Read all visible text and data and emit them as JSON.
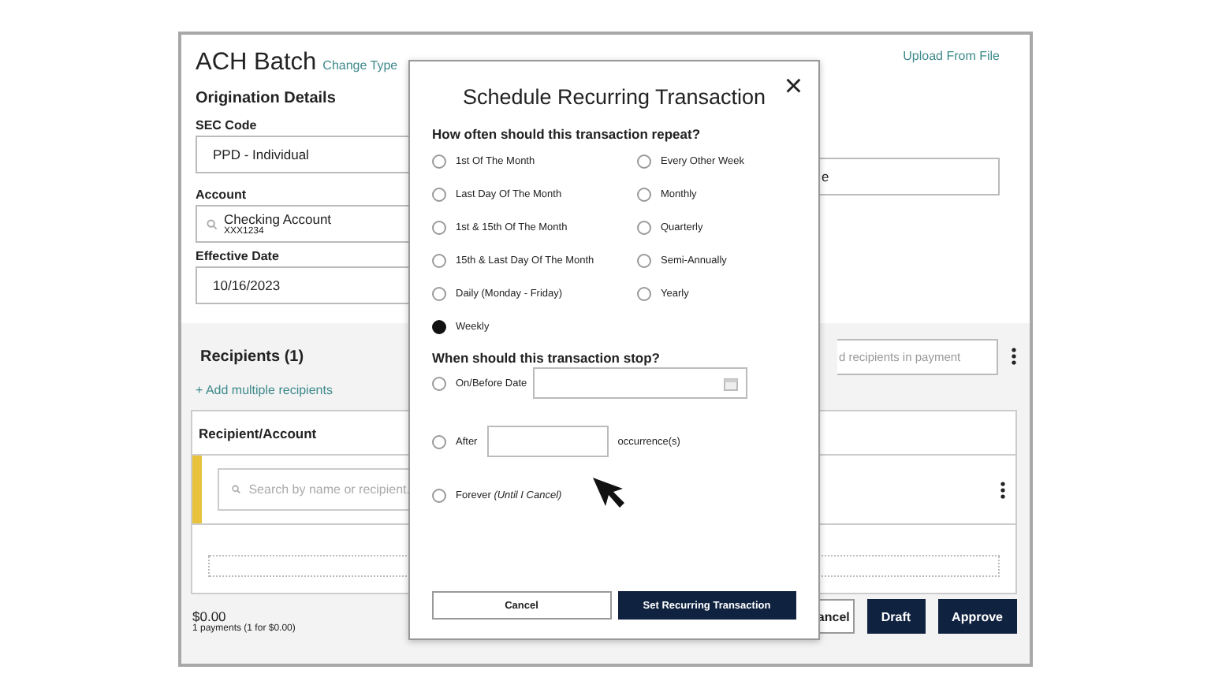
{
  "page": {
    "title": "ACH Batch",
    "change_link": "Change Type",
    "upload_link": "Upload From File",
    "section": "Origination Details",
    "fields": [
      {
        "label": "SEC Code",
        "value": "PPD - Individual"
      },
      {
        "label": "Account",
        "value": "Checking Account",
        "sub": "XXX1234",
        "kind": "search"
      },
      {
        "label": "Effective Date",
        "value": "10/16/2023"
      }
    ],
    "right_field_value": "e"
  },
  "recipients": {
    "title": "Recipients (1)",
    "search_placeholder": "d recipients in payment",
    "add_link": "+ Add multiple recipients",
    "column": "Recipient/Account",
    "row_search_placeholder": "Search by name or recipient.",
    "total": "$0.00",
    "summary": "1 payments (1 for $0.00)"
  },
  "footer_buttons": [
    {
      "label": "ancel",
      "kind": "secondary"
    },
    {
      "label": "Draft",
      "kind": "primary"
    },
    {
      "label": "Approve",
      "kind": "primary"
    }
  ],
  "modal": {
    "title": "Schedule Recurring Transaction",
    "close": "×",
    "repeat_question": "How often should this transaction repeat?",
    "repeat_options": [
      {
        "label": "1st Of The Month",
        "selected": false
      },
      {
        "label": "Every Other Week",
        "selected": false
      },
      {
        "label": "Last Day Of The Month",
        "selected": false
      },
      {
        "label": "Monthly",
        "selected": false
      },
      {
        "label": "1st & 15th Of The Month",
        "selected": false
      },
      {
        "label": "Quarterly",
        "selected": false
      },
      {
        "label": "15th & Last Day Of The Month",
        "selected": false
      },
      {
        "label": "Semi-Annually",
        "selected": false
      },
      {
        "label": "Daily (Monday - Friday)",
        "selected": false
      },
      {
        "label": "Yearly",
        "selected": false
      },
      {
        "label": "Weekly",
        "selected": true
      }
    ],
    "stop_question": "When should this transaction stop?",
    "stop_options": [
      {
        "label": "On/Before Date",
        "kind": "date",
        "selected": false
      },
      {
        "label": "After",
        "kind": "count",
        "suffix": "occurrence(s)",
        "selected": false
      },
      {
        "label": "Forever *(Until I Cancel)*",
        "kind": "plain",
        "selected": false
      }
    ],
    "buttons": [
      {
        "label": "Cancel",
        "kind": "secondary"
      },
      {
        "label": "Set Recurring Transaction",
        "kind": "primary"
      }
    ]
  }
}
